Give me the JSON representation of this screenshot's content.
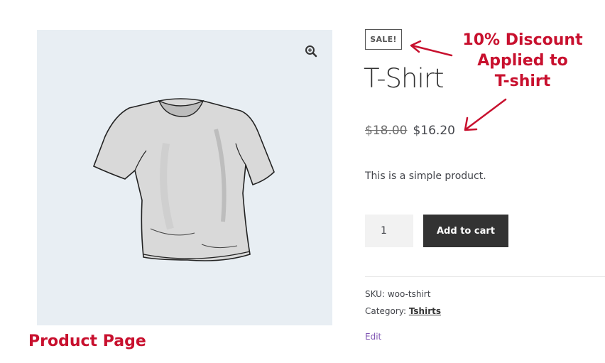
{
  "product": {
    "badge": "SALE!",
    "title": "T-Shirt",
    "regular_price": "$18.00",
    "sale_price": "$16.20",
    "description": "This is a simple product.",
    "quantity": "1",
    "add_to_cart_label": "Add to cart",
    "sku_label": "SKU:",
    "sku_value": "woo-tshirt",
    "category_label": "Category:",
    "category_value": "Tshirts",
    "edit_label": "Edit",
    "zoom_icon": "magnifier-plus-icon"
  },
  "annotations": {
    "discount_note_line1": "10% Discount",
    "discount_note_line2": "Applied to",
    "discount_note_line3": "T-shirt",
    "page_label": "Product Page",
    "color": "#c8102e"
  },
  "colors": {
    "image_background": "#e8eef3",
    "button_background": "#333333",
    "edit_link": "#7f54b3"
  }
}
